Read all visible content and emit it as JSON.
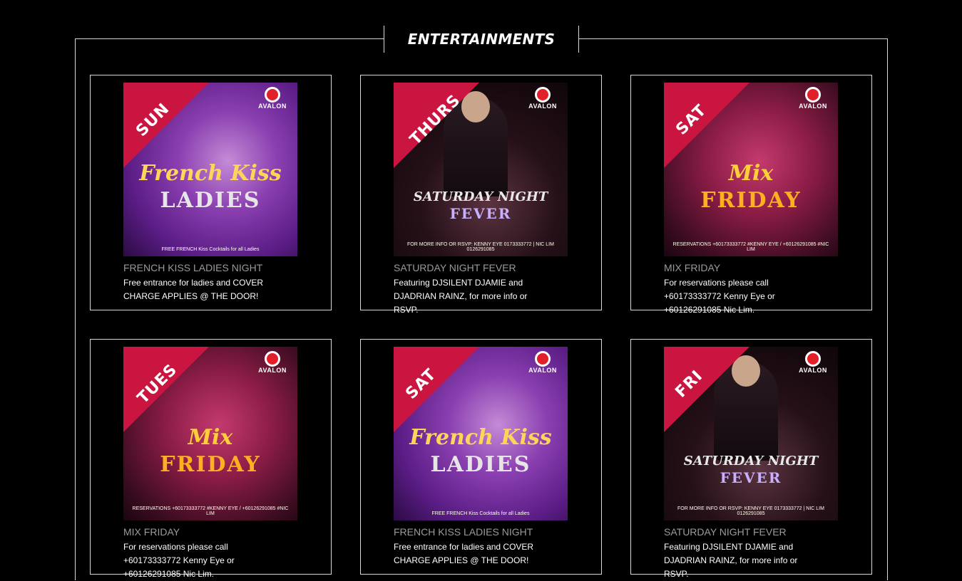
{
  "section": {
    "title": "ENTERTAINMENTS"
  },
  "logo": {
    "name": "AVALON"
  },
  "cards": [
    {
      "title": "FRENCH KISS LADIES NIGHT",
      "description": "Free entrance for ladies and COVER CHARGE APPLIES @ THE DOOR!",
      "poster": {
        "day": "SUN",
        "headline": "French Kiss",
        "subline": "LADIES",
        "info": "FREE FRENCH Kiss Cocktails for all Ladies",
        "theme": "ladies"
      }
    },
    {
      "title": "SATURDAY NIGHT FEVER",
      "description": "Featuring DJSILENT DJAMIE and DJADRIAN RAINZ, for more info or RSVP.",
      "poster": {
        "day": "THURS",
        "headline": "SATURDAY NIGHT",
        "subline": "FEVER",
        "info": "FOR MORE INFO OR RSVP: KENNY EYE 0173333772 | NIC LIM 0126291085",
        "theme": "fever"
      }
    },
    {
      "title": "MIX FRIDAY",
      "description": "For reservations please call +60173333772 Kenny Eye or +60126291085 Nic Lim.",
      "poster": {
        "day": "SAT",
        "headline": "Mix",
        "subline": "FRIDAY",
        "info": "RESERVATIONS +60173333772 #KENNY EYE / +60126291085 #NIC LIM",
        "theme": "mix"
      }
    },
    {
      "title": "MIX FRIDAY",
      "description": "For reservations please call +60173333772 Kenny Eye or +60126291085 Nic Lim.",
      "poster": {
        "day": "TUES",
        "headline": "Mix",
        "subline": "FRIDAY",
        "info": "RESERVATIONS +60173333772 #KENNY EYE / +60126291085 #NIC LIM",
        "theme": "mix"
      }
    },
    {
      "title": "FRENCH KISS LADIES NIGHT",
      "description": "Free entrance for ladies and COVER CHARGE APPLIES @ THE DOOR!",
      "poster": {
        "day": "SAT",
        "headline": "French Kiss",
        "subline": "LADIES",
        "info": "FREE FRENCH Kiss Cocktails for all Ladies",
        "theme": "ladies"
      }
    },
    {
      "title": "SATURDAY NIGHT FEVER",
      "description": "Featuring DJSILENT DJAMIE and DJADRIAN RAINZ, for more info or RSVP.",
      "poster": {
        "day": "FRI",
        "headline": "SATURDAY NIGHT",
        "subline": "FEVER",
        "info": "FOR MORE INFO OR RSVP: KENNY EYE 0173333772 | NIC LIM 0126291085",
        "theme": "fever"
      }
    }
  ],
  "colors": {
    "background": "#000000",
    "border": "#d8d8d8",
    "accent_red": "#c9153f",
    "title_grey": "#9a9a9a"
  }
}
